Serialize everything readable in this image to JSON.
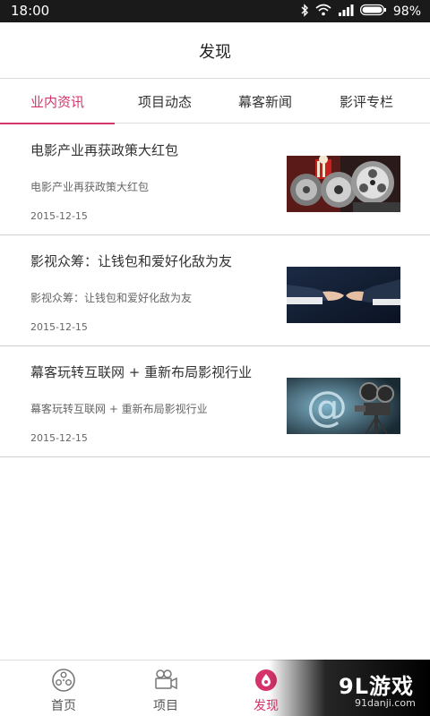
{
  "status_bar": {
    "time": "18:00",
    "battery_percent": "98%"
  },
  "header": {
    "title": "发现"
  },
  "tabs": [
    {
      "label": "业内资讯",
      "active": true
    },
    {
      "label": "项目动态",
      "active": false
    },
    {
      "label": "幕客新闻",
      "active": false
    },
    {
      "label": "影评专栏",
      "active": false
    }
  ],
  "news": [
    {
      "title": "电影产业再获政策大红包",
      "summary": "电影产业再获政策大红包",
      "date": "2015-12-15",
      "thumbnail": "film-reels-popcorn"
    },
    {
      "title": "影视众筹：让钱包和爱好化敌为友",
      "summary": "影视众筹：让钱包和爱好化敌为友",
      "date": "2015-12-15",
      "thumbnail": "handshake",
      "thumbnail_caption": "影视众筹：让钱包和爱好化敌为友"
    },
    {
      "title": "幕客玩转互联网 + 重新布局影视行业",
      "summary": "幕客玩转互联网 + 重新布局影视行业",
      "date": "2015-12-15",
      "thumbnail": "at-sign-projector"
    }
  ],
  "bottom_nav": [
    {
      "label": "首页",
      "icon": "film-reel-icon",
      "active": false
    },
    {
      "label": "项目",
      "icon": "camera-icon",
      "active": false
    },
    {
      "label": "发现",
      "icon": "discover-drop-icon",
      "active": true
    }
  ],
  "watermark": {
    "logo": "9L游戏",
    "url": "91danji.com"
  },
  "colors": {
    "accent": "#d6336c",
    "status_bar": "#1a1a1a"
  }
}
